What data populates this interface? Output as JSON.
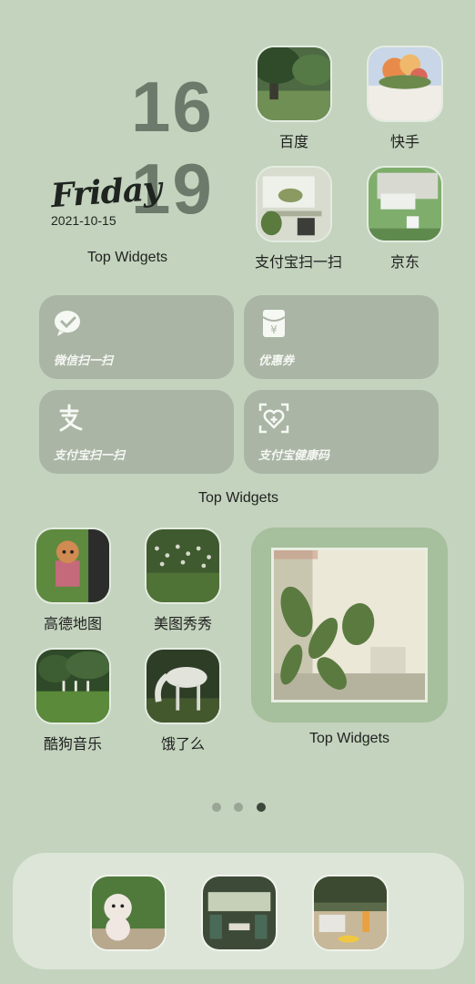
{
  "clock": {
    "hour": "16",
    "minute": "19",
    "weekday": "Friday",
    "date": "2021-10-15",
    "widget_label": "Top Widgets"
  },
  "apps_top": [
    {
      "name": "百度"
    },
    {
      "name": "快手"
    },
    {
      "name": "支付宝扫一扫"
    },
    {
      "name": "京东"
    }
  ],
  "shortcuts": {
    "items": [
      {
        "label": "微信扫一扫",
        "icon": "wechat-icon"
      },
      {
        "label": "优惠券",
        "icon": "coupon-icon"
      },
      {
        "label": "支付宝扫一扫",
        "icon": "alipay-icon"
      },
      {
        "label": "支付宝健康码",
        "icon": "health-code-icon"
      }
    ],
    "widget_label": "Top Widgets"
  },
  "apps_bottom": [
    {
      "name": "高德地图"
    },
    {
      "name": "美图秀秀"
    },
    {
      "name": "酷狗音乐"
    },
    {
      "name": "饿了么"
    }
  ],
  "photo_widget": {
    "label": "Top Widgets"
  },
  "page_dots": {
    "count": 3,
    "active_index": 2,
    "colors": {
      "inactive": "#9aa596",
      "active": "#3c463a"
    }
  },
  "colors": {
    "background": "#c3d3bd",
    "card": "#aab5a5",
    "clock": "#6b7a6a"
  }
}
